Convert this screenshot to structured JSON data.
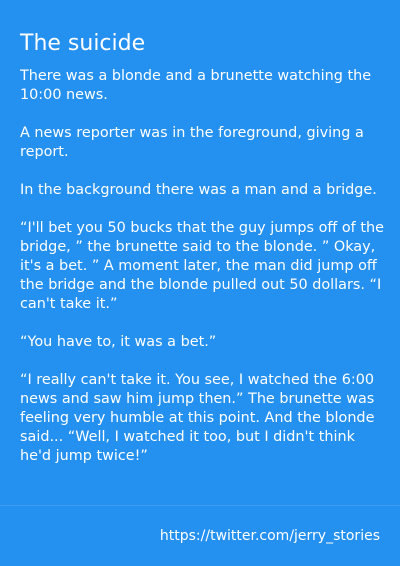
{
  "story": {
    "title": "The suicide",
    "paragraphs": [
      "There was a blonde and a brunette watching the 10:00 news.",
      "A news reporter was in the foreground, giving a report.",
      "In the background there was a man and a bridge.",
      "“I'll bet you 50 bucks that the guy jumps off of the bridge, ” the brunette said to the blonde. ” Okay, it's a bet. ” A moment later, the man did jump off the bridge and the blonde pulled out 50 dollars. “I can't take it.”",
      "“You have to, it was a bet.”",
      "“I really can't take it. You see, I watched the 6:00 news and saw him jump then.” The brunette was feeling very humble at this point. And the blonde said... “Well, I watched it too, but I didn't think he'd jump twice!”"
    ]
  },
  "footer": {
    "link_text": "https://twitter.com/jerry_stories"
  },
  "colors": {
    "background": "#2490f0",
    "text": "#ffffff"
  }
}
